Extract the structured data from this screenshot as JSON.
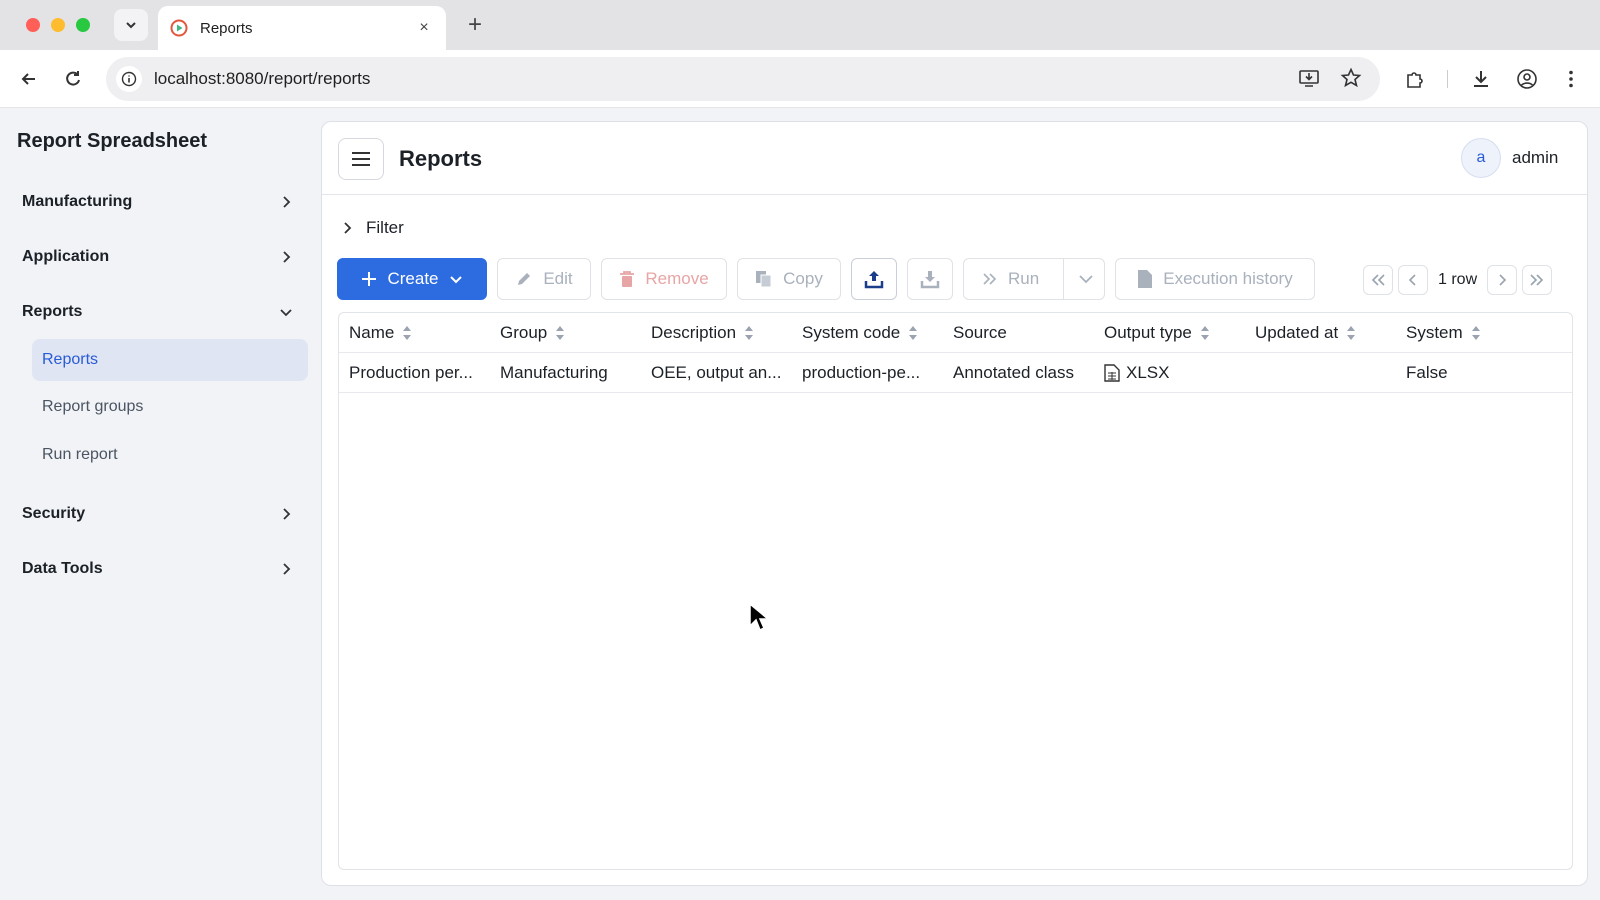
{
  "browser": {
    "tab_title": "Reports",
    "tab_close": "×",
    "new_tab": "+",
    "url": "localhost:8080/report/reports"
  },
  "sidebar": {
    "app_title": "Report Spreadsheet",
    "groups": [
      {
        "label": "Manufacturing",
        "expanded": false
      },
      {
        "label": "Application",
        "expanded": false
      },
      {
        "label": "Reports",
        "expanded": true
      },
      {
        "label": "Security",
        "expanded": false
      },
      {
        "label": "Data Tools",
        "expanded": false
      }
    ],
    "report_items": [
      {
        "label": "Reports",
        "active": true
      },
      {
        "label": "Report groups",
        "active": false
      },
      {
        "label": "Run report",
        "active": false
      }
    ]
  },
  "header": {
    "title": "Reports",
    "avatar_initial": "a",
    "username": "admin"
  },
  "filter": {
    "label": "Filter"
  },
  "toolbar": {
    "create": "Create",
    "edit": "Edit",
    "remove": "Remove",
    "copy": "Copy",
    "run": "Run",
    "execution_history": "Execution history"
  },
  "pagination": {
    "row_count": "1 row"
  },
  "table": {
    "columns": [
      "Name",
      "Group",
      "Description",
      "System code",
      "Source",
      "Output type",
      "Updated at",
      "System"
    ],
    "rows": [
      {
        "name": "Production per...",
        "group": "Manufacturing",
        "description": "OEE, output an...",
        "system_code": "production-pe...",
        "source": "Annotated class",
        "output_type": "XLSX",
        "updated_at": "",
        "system": "False"
      }
    ]
  },
  "colors": {
    "primary": "#2d6be0",
    "active_bg": "#dfe5f2",
    "active_text": "#2a5bd7"
  }
}
